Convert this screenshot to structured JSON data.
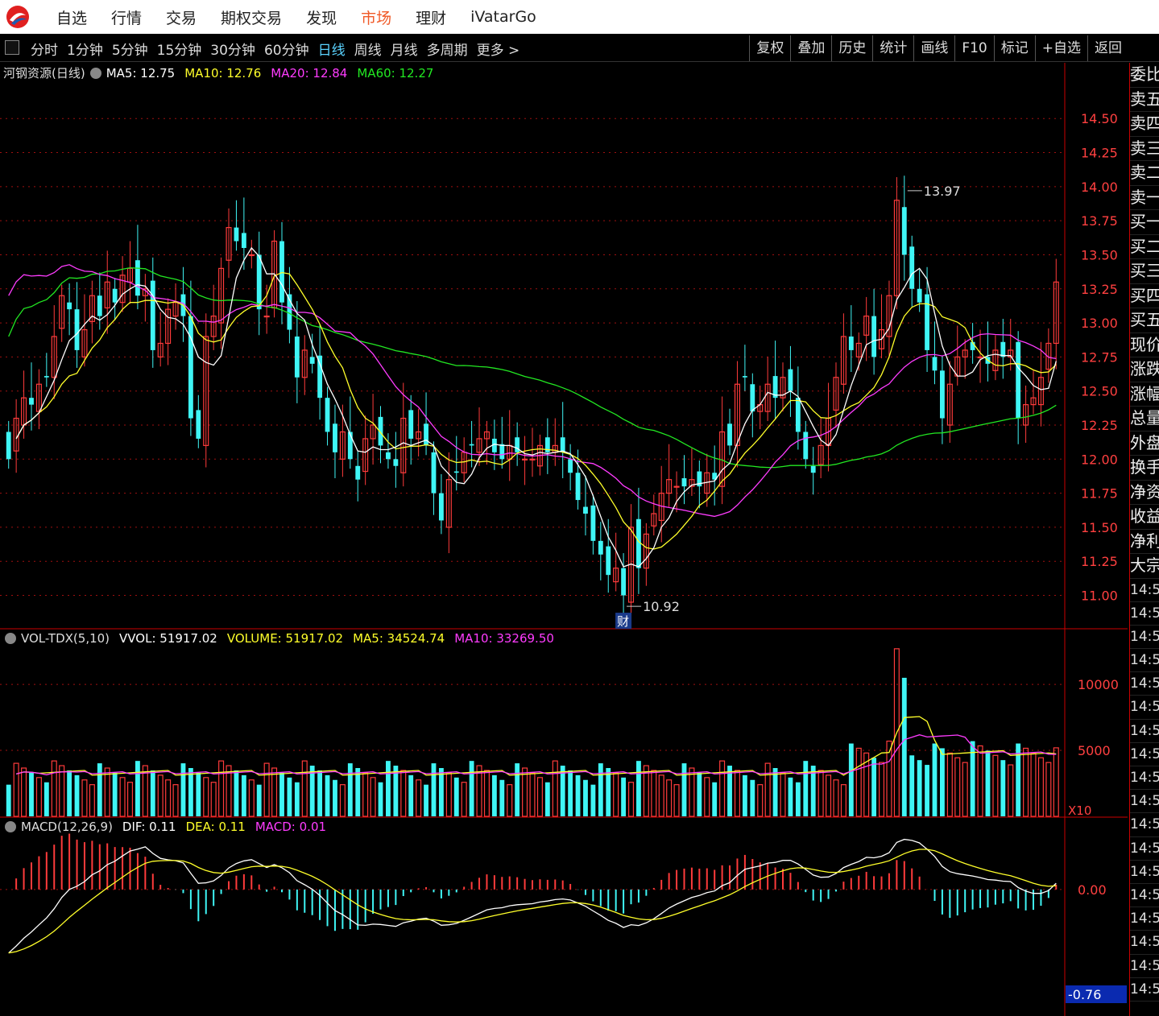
{
  "topmenu": {
    "items": [
      "自选",
      "行情",
      "交易",
      "期权交易",
      "发现",
      "市场",
      "理财",
      "iVatarGo"
    ],
    "active_index": 5
  },
  "toolbar": {
    "periods": [
      "分时",
      "1分钟",
      "5分钟",
      "15分钟",
      "30分钟",
      "60分钟",
      "日线",
      "周线",
      "月线",
      "多周期",
      "更多 >"
    ],
    "active_index": 6,
    "tools": [
      "复权",
      "叠加",
      "历史",
      "统计",
      "画线",
      "F10",
      "标记",
      "+自选",
      "返回"
    ]
  },
  "main_legend": {
    "title": "河钢资源(日线)",
    "ma5": "MA5: 12.75",
    "ma10": "MA10: 12.76",
    "ma20": "MA20: 12.84",
    "ma60": "MA60: 12.27"
  },
  "vol_legend": {
    "title": "VOL-TDX(5,10)",
    "vvol": "VVOL: 51917.02",
    "volume": "VOLUME: 51917.02",
    "ma5": "MA5: 34524.74",
    "ma10": "MA10: 33269.50"
  },
  "macd_legend": {
    "title": "MACD(12,26,9)",
    "dif": "DIF: 0.11",
    "dea": "DEA: 0.11",
    "macd": "MACD: 0.01"
  },
  "price_axis": [
    "14.50",
    "14.25",
    "14.00",
    "13.75",
    "13.50",
    "13.25",
    "13.00",
    "12.75",
    "12.50",
    "12.25",
    "12.00",
    "11.75",
    "11.50",
    "11.25",
    "11.00"
  ],
  "vol_axis": [
    "10000",
    "5000"
  ],
  "vol_unit": "X10",
  "macd_axis": {
    "zero": "0.00",
    "min": "-0.76"
  },
  "annotations": {
    "high": "13.97",
    "low": "10.92",
    "event": "财"
  },
  "right_panel": {
    "labels": [
      "委比",
      "卖五",
      "卖四",
      "卖三",
      "卖二",
      "卖一",
      "买一",
      "买二",
      "买三",
      "买四",
      "买五",
      "现价",
      "涨跌",
      "涨幅",
      "总量",
      "外盘",
      "换手",
      "净资",
      "收益",
      "净利",
      "大宗"
    ],
    "times": [
      "14:5",
      "14:5",
      "14:5",
      "14:5",
      "14:5",
      "14:5",
      "14:5",
      "14:5",
      "14:5",
      "14:5",
      "14:5",
      "14:5",
      "14:5",
      "14:5",
      "14:5",
      "14:5",
      "14:5",
      "14:5"
    ]
  },
  "colors": {
    "up": "#ff3b3b",
    "down": "#3ff5f5",
    "ma5": "#ffffff",
    "ma10": "#ffff2a",
    "ma20": "#ff3cff",
    "ma60": "#22e822",
    "grid": "#a01010"
  },
  "chart_data": {
    "type": "candlestick",
    "y_range": [
      10.82,
      14.85
    ],
    "closes": [
      12.0,
      12.3,
      12.45,
      12.4,
      12.55,
      12.6,
      12.9,
      13.2,
      13.1,
      12.8,
      12.95,
      13.2,
      13.05,
      13.3,
      13.15,
      13.35,
      13.4,
      13.2,
      13.25,
      12.8,
      12.85,
      13.1,
      13.15,
      13.05,
      12.3,
      12.15,
      12.9,
      13.05,
      13.4,
      13.7,
      13.6,
      13.55,
      13.5,
      13.1,
      13.05,
      13.6,
      13.15,
      12.95,
      12.6,
      12.8,
      12.7,
      12.45,
      12.2,
      12.05,
      12.2,
      12.0,
      11.85,
      12.15,
      12.25,
      12.1,
      12.0,
      11.95,
      12.3,
      12.15,
      12.2,
      12.1,
      11.75,
      11.55,
      11.85,
      11.9,
      12.05,
      12.1,
      12.15,
      12.2,
      12.05,
      12.0,
      12.1,
      12.05,
      12.0,
      12.0,
      12.1,
      12.05,
      12.1,
      12.05,
      11.9,
      11.7,
      11.6,
      11.4,
      11.3,
      11.15,
      11.2,
      11.0,
      11.5,
      11.2,
      11.45,
      11.6,
      11.75,
      11.85,
      11.8,
      11.8,
      11.85,
      11.8,
      11.9,
      11.85,
      12.2,
      12.1,
      12.55,
      12.6,
      12.35,
      12.4,
      12.55,
      12.45,
      12.6,
      12.5,
      12.2,
      12.0,
      11.9,
      12.1,
      12.3,
      12.6,
      12.9,
      12.8,
      12.85,
      13.05,
      12.75,
      12.95,
      13.2,
      13.9,
      13.5,
      13.25,
      13.15,
      12.8,
      12.65,
      12.3,
      12.55,
      12.75,
      12.8,
      12.8,
      12.75,
      12.7,
      12.8,
      12.75,
      12.8,
      12.3,
      12.4,
      12.45,
      12.6,
      12.85,
      13.3
    ],
    "ma_last": {
      "MA5": 12.75,
      "MA10": 12.76,
      "MA20": 12.84,
      "MA60": 12.27
    },
    "high_marker": 13.97,
    "low_marker": 10.92,
    "volume_range": [
      0,
      13300
    ],
    "volume_last": 5191.7,
    "macd_range": [
      -0.76,
      0.45
    ],
    "macd_last": {
      "DIF": 0.11,
      "DEA": 0.11,
      "MACD": 0.01
    }
  }
}
